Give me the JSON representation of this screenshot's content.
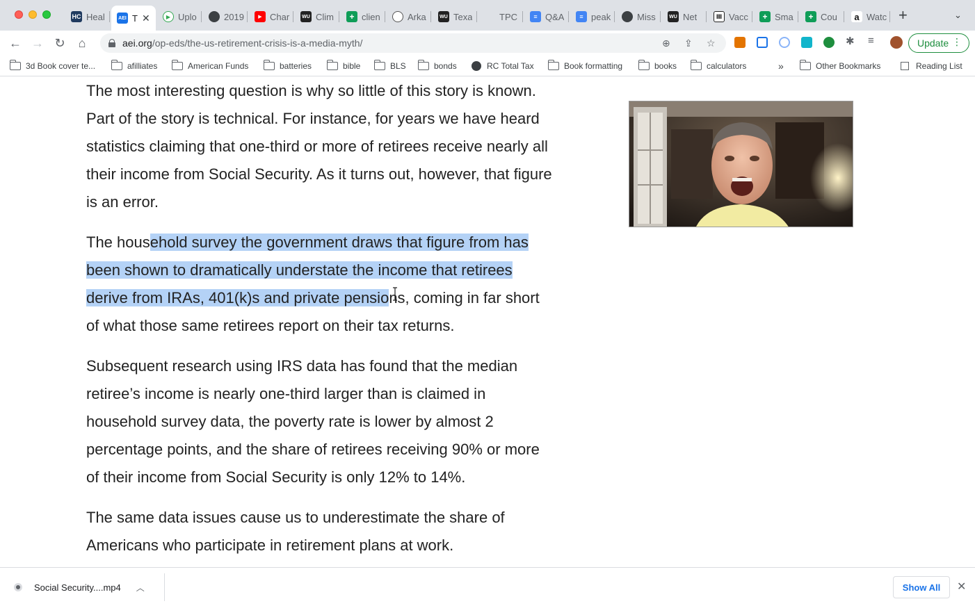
{
  "tabs": [
    {
      "title": "Heal",
      "favicon": "HC",
      "color": "#1f3a5f"
    },
    {
      "title": "T",
      "favicon": "AEI",
      "color": "#1a73e8",
      "active": true
    },
    {
      "title": "Uplo",
      "favicon": "play-circle-icon",
      "color": "#34a853"
    },
    {
      "title": "2019",
      "favicon": "globe-icon",
      "color": "#3c4043"
    },
    {
      "title": "Char",
      "favicon": "youtube-icon",
      "color": "#ff0000"
    },
    {
      "title": "Clim",
      "favicon": "WU",
      "color": "#222222"
    },
    {
      "title": "clien",
      "favicon": "sheets-icon",
      "color": "#0f9d58"
    },
    {
      "title": "Arka",
      "favicon": "chart-icon",
      "color": "#555555"
    },
    {
      "title": "Texa",
      "favicon": "WU",
      "color": "#222222"
    },
    {
      "title": "TPC",
      "favicon": "",
      "color": "#ffffff"
    },
    {
      "title": "Q&A",
      "favicon": "docs-icon",
      "color": "#4285f4"
    },
    {
      "title": "peak",
      "favicon": "docs-icon",
      "color": "#4285f4"
    },
    {
      "title": "Miss",
      "favicon": "globe-icon",
      "color": "#3c4043"
    },
    {
      "title": "Net",
      "favicon": "WU",
      "color": "#222222"
    },
    {
      "title": "Vacc",
      "favicon": "library-icon",
      "color": "#222222"
    },
    {
      "title": "Sma",
      "favicon": "sheets-icon",
      "color": "#0f9d58"
    },
    {
      "title": "Cou",
      "favicon": "sheets-icon",
      "color": "#0f9d58"
    },
    {
      "title": "Watc",
      "favicon": "a",
      "color": "#ffffff"
    }
  ],
  "toolbar": {
    "url_domain": "aei.org",
    "url_path": "/op-eds/the-us-retirement-crisis-is-a-media-myth/",
    "update_label": "Update"
  },
  "bookmarks": [
    {
      "label": "3d Book cover te...",
      "type": "folder"
    },
    {
      "label": "afilliates",
      "type": "folder"
    },
    {
      "label": "American Funds",
      "type": "folder"
    },
    {
      "label": "batteries",
      "type": "folder"
    },
    {
      "label": "bible",
      "type": "folder"
    },
    {
      "label": "BLS",
      "type": "folder"
    },
    {
      "label": "bonds",
      "type": "folder"
    },
    {
      "label": "RC Total Tax",
      "type": "globe"
    },
    {
      "label": "Book formatting",
      "type": "folder"
    },
    {
      "label": "books",
      "type": "folder"
    },
    {
      "label": "calculators",
      "type": "folder"
    }
  ],
  "bookmarks_overflow": "»",
  "other_bookmarks": "Other Bookmarks",
  "reading_list": "Reading List",
  "article": {
    "p1": "The most interesting question is why so little of this story is known. Part of the story is technical. For instance, for years we have heard statistics claiming that one-third or more of retirees receive nearly all their income from Social Security. As it turns out, however, that figure is an error.",
    "p2_before": "The hous",
    "p2_selected": "ehold survey the government draws that figure from has been shown to dramatically understate the income that retirees derive from IRAs, 401(k)s and private pensio",
    "p2_after": "ns, coming in far short of what those same retirees report on their tax returns.",
    "p3": "Subsequent research using IRS data has found that the median retiree’s income is nearly one-third larger than is claimed in household survey data, the poverty rate is lower by almost 2 percentage points, and the share of retirees receiving 90% or more of their income from Social Security is only 12% to 14%.",
    "p4": "The same data issues cause us to underestimate the share of Americans who participate in retirement plans at work."
  },
  "download": {
    "filename": "Social Security....mp4",
    "show_all": "Show All"
  }
}
